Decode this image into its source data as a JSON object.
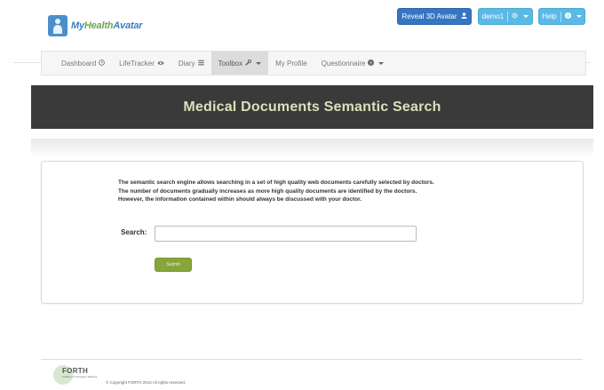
{
  "header": {
    "logo": {
      "my": "My",
      "health": "Health",
      "avatar": "Avatar"
    },
    "reveal_button": {
      "label": "Reveal 3D Avatar",
      "icon": "user-icon"
    },
    "user_menu": {
      "label": "demo1",
      "icon": "gear-icon"
    },
    "help_menu": {
      "label": "Help",
      "icon": "info-circle-icon"
    }
  },
  "nav": {
    "items": [
      {
        "label": "Dashboard",
        "icon": "clock-icon"
      },
      {
        "label": "LifeTracker",
        "icon": "eye-icon"
      },
      {
        "label": "Diary",
        "icon": "list-icon"
      },
      {
        "label": "Toolbox",
        "icon": "wrench-icon",
        "active": true
      },
      {
        "label": "My Profile"
      },
      {
        "label": "Questionnaire",
        "icon": "question-circle-icon"
      }
    ]
  },
  "banner": {
    "title": "Medical Documents Semantic Search"
  },
  "content": {
    "description": [
      "The semantic search engine allows searching in a set of high quality web documents carefully selected by doctors.",
      "The number of documents gradually increases as more high quality documents are identified by the doctors.",
      "However, the information contained within should always be discussed with your doctor."
    ],
    "search": {
      "label": "Search:",
      "value": "",
      "placeholder": ""
    },
    "submit_label": "Submit"
  },
  "footer": {
    "logo_name": "FORTH",
    "logo_sub": "Institute of Computer Science",
    "copyright": "© Copyright FORTH 2014 All rights reserved."
  },
  "colors": {
    "primary": "#3575c2",
    "info": "#5bb9e5",
    "banner_bg": "#3a3a3a",
    "banner_text": "#d8e2b7",
    "submit": "#86a53a"
  }
}
